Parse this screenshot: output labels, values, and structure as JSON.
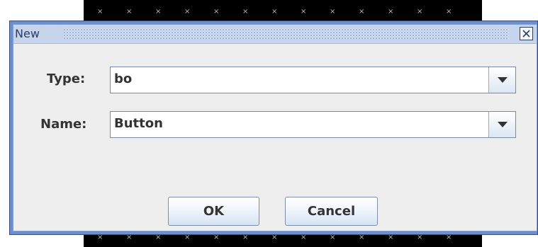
{
  "dialog": {
    "title": "New",
    "close_icon": "close-icon"
  },
  "form": {
    "type_label": "Type:",
    "type_value": "bo",
    "name_label": "Name:",
    "name_value": "Button",
    "dropdown_icon": "chevron-down-icon"
  },
  "buttons": {
    "ok_label": "OK",
    "cancel_label": "Cancel"
  },
  "colors": {
    "window_border": "#6b8fd0",
    "titlebar": "#c6d4ec",
    "background": "#eeeeee"
  }
}
